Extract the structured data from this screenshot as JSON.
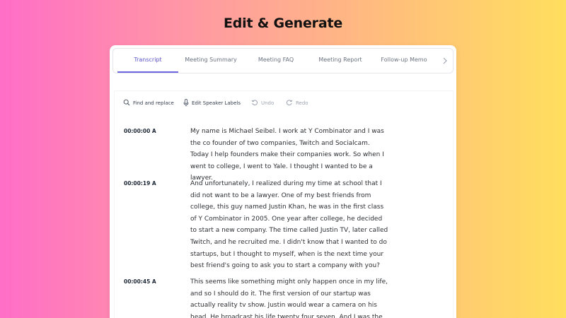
{
  "header": {
    "title": "Edit & Generate"
  },
  "tabs": [
    {
      "label": "Transcript",
      "active": true
    },
    {
      "label": "Meeting Summary",
      "active": false
    },
    {
      "label": "Meeting FAQ",
      "active": false
    },
    {
      "label": "Meeting Report",
      "active": false
    },
    {
      "label": "Follow-up Memo",
      "active": false
    }
  ],
  "toolbar": {
    "find_replace": "Find and replace",
    "edit_speaker_labels": "Edit Speaker Labels",
    "undo": "Undo",
    "redo": "Redo"
  },
  "transcript": [
    {
      "timestamp": "00:00:00 A",
      "text": "My name is Michael Seibel. I work at Y Combinator and I was the co founder of two companies, Twitch and Socialcam. Today I help founders make their companies work. So when I went to college, I went to Yale. I thought I wanted to be a lawyer."
    },
    {
      "timestamp": "00:00:19 A",
      "text": "And unfortunately, I realized during my time at school that I did not want to be a lawyer. One of my best friends from college, this guy named Justin Khan, he was in the first class of Y Combinator in 2005. One year after college, he decided to start a new company. The time called Justin TV, later called Twitch, and he recruited me. I didn't know that I wanted to do startups, but I thought to myself, when is the next time your best friend's going to ask you to start a company with you?"
    },
    {
      "timestamp": "00:00:45 A",
      "text": "This seems like something might only happen once in my life, and so I should do it. The first version of our startup was actually reality tv show. Justin would wear a camera on his head. He broadcast his life twenty four seven. And I was the"
    }
  ],
  "colors": {
    "accent": "#6e67e0",
    "active_tab_text": "#5b54c9",
    "gradient": [
      "#ff6ec7",
      "#ff9aa2",
      "#ffc07a",
      "#ffdf5e"
    ]
  }
}
